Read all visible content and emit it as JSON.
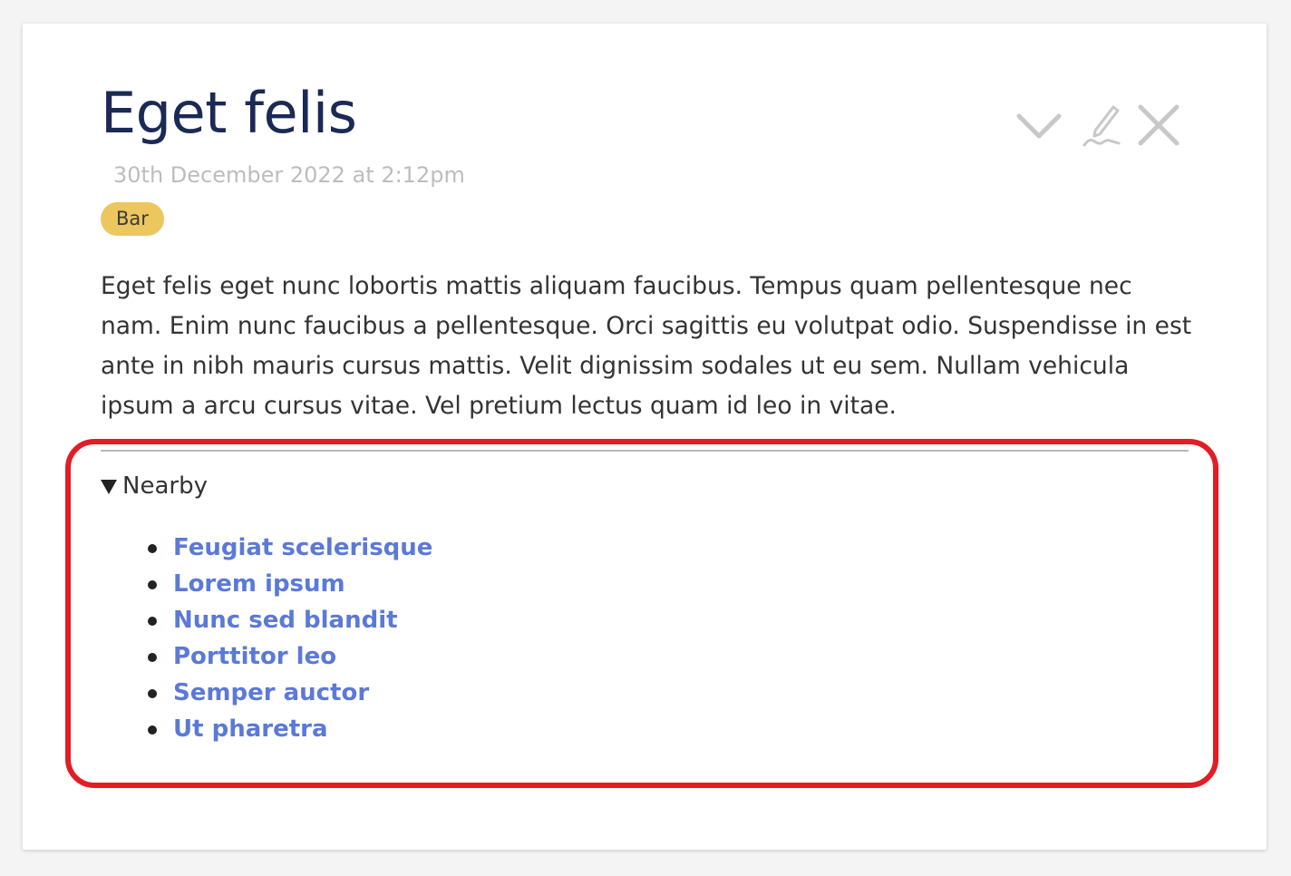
{
  "tiddler": {
    "title": "Eget felis",
    "subtitle": "30th December 2022 at 2:12pm",
    "tags": [
      "Bar"
    ],
    "text": "Eget felis eget nunc lobortis mattis aliquam faucibus. Tempus quam pellentesque nec nam. Enim nunc faucibus a pellentesque. Orci sagittis eu volutpat odio. Suspendisse in est ante in nibh mauris cursus mattis. Velit dignissim sodales ut eu sem. Nullam vehicula ipsum a arcu cursus vitae. Vel pretium lectus quam id leo in vitae."
  },
  "controls": {
    "more": "chevron-down-icon",
    "edit": "pencil-icon",
    "close": "close-icon"
  },
  "nearby": {
    "summary": "Nearby",
    "links": [
      "Feugiat scelerisque",
      "Lorem ipsum",
      "Nunc sed blandit",
      "Porttitor leo",
      "Semper auctor",
      "Ut pharetra"
    ]
  },
  "colors": {
    "title": "#1b2a55",
    "tag_bg": "#ecc75f",
    "link": "#5b79d8",
    "highlight": "#e11d26",
    "icon": "#c8c8c8"
  }
}
